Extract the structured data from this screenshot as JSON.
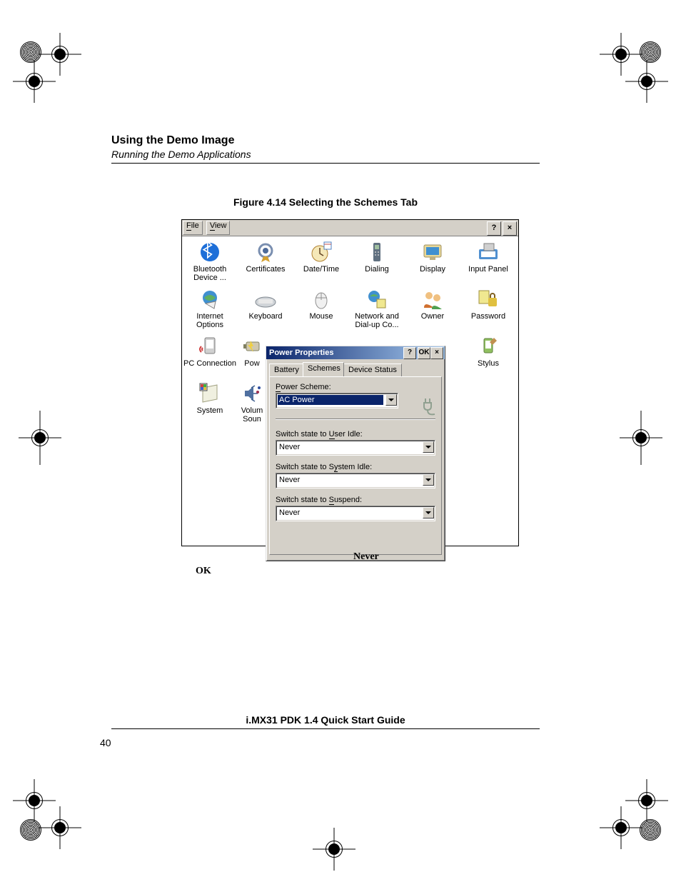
{
  "header": {
    "title": "Using the Demo Image",
    "subtitle": "Running the Demo Applications"
  },
  "figure_caption": "Figure 4.14  Selecting the Schemes Tab",
  "menubar": {
    "file": "File",
    "view": "View",
    "help": "?",
    "close": "×"
  },
  "cp_items": [
    {
      "label": "Bluetooth Device ..."
    },
    {
      "label": "Certificates"
    },
    {
      "label": "Date/Time"
    },
    {
      "label": "Dialing"
    },
    {
      "label": "Display"
    },
    {
      "label": "Input Panel"
    },
    {
      "label": "Internet Options"
    },
    {
      "label": "Keyboard"
    },
    {
      "label": "Mouse"
    },
    {
      "label": "Network and Dial-up Co..."
    },
    {
      "label": "Owner"
    },
    {
      "label": "Password"
    },
    {
      "label": "PC Connection"
    },
    {
      "label": "Pow"
    },
    {
      "label": "Stylus"
    },
    {
      "label": "System"
    },
    {
      "label": "Volum Soun"
    }
  ],
  "dialog": {
    "title": "Power Properties",
    "help": "?",
    "ok": "OK",
    "close": "×",
    "tabs": {
      "battery": "Battery",
      "schemes": "Schemes",
      "device": "Device Status"
    },
    "scheme_label": "Power Scheme:",
    "scheme_value": "AC Power",
    "user_idle_label": "Switch state to User Idle:",
    "user_idle_value": "Never",
    "system_idle_label": "Switch state to System Idle:",
    "system_idle_value": "Never",
    "suspend_label": "Switch state to Suspend:",
    "suspend_value": "Never"
  },
  "undertext": {
    "never": "Never",
    "ok": "OK"
  },
  "footer": {
    "title": "i.MX31 PDK 1.4 Quick Start Guide",
    "page": "40"
  }
}
